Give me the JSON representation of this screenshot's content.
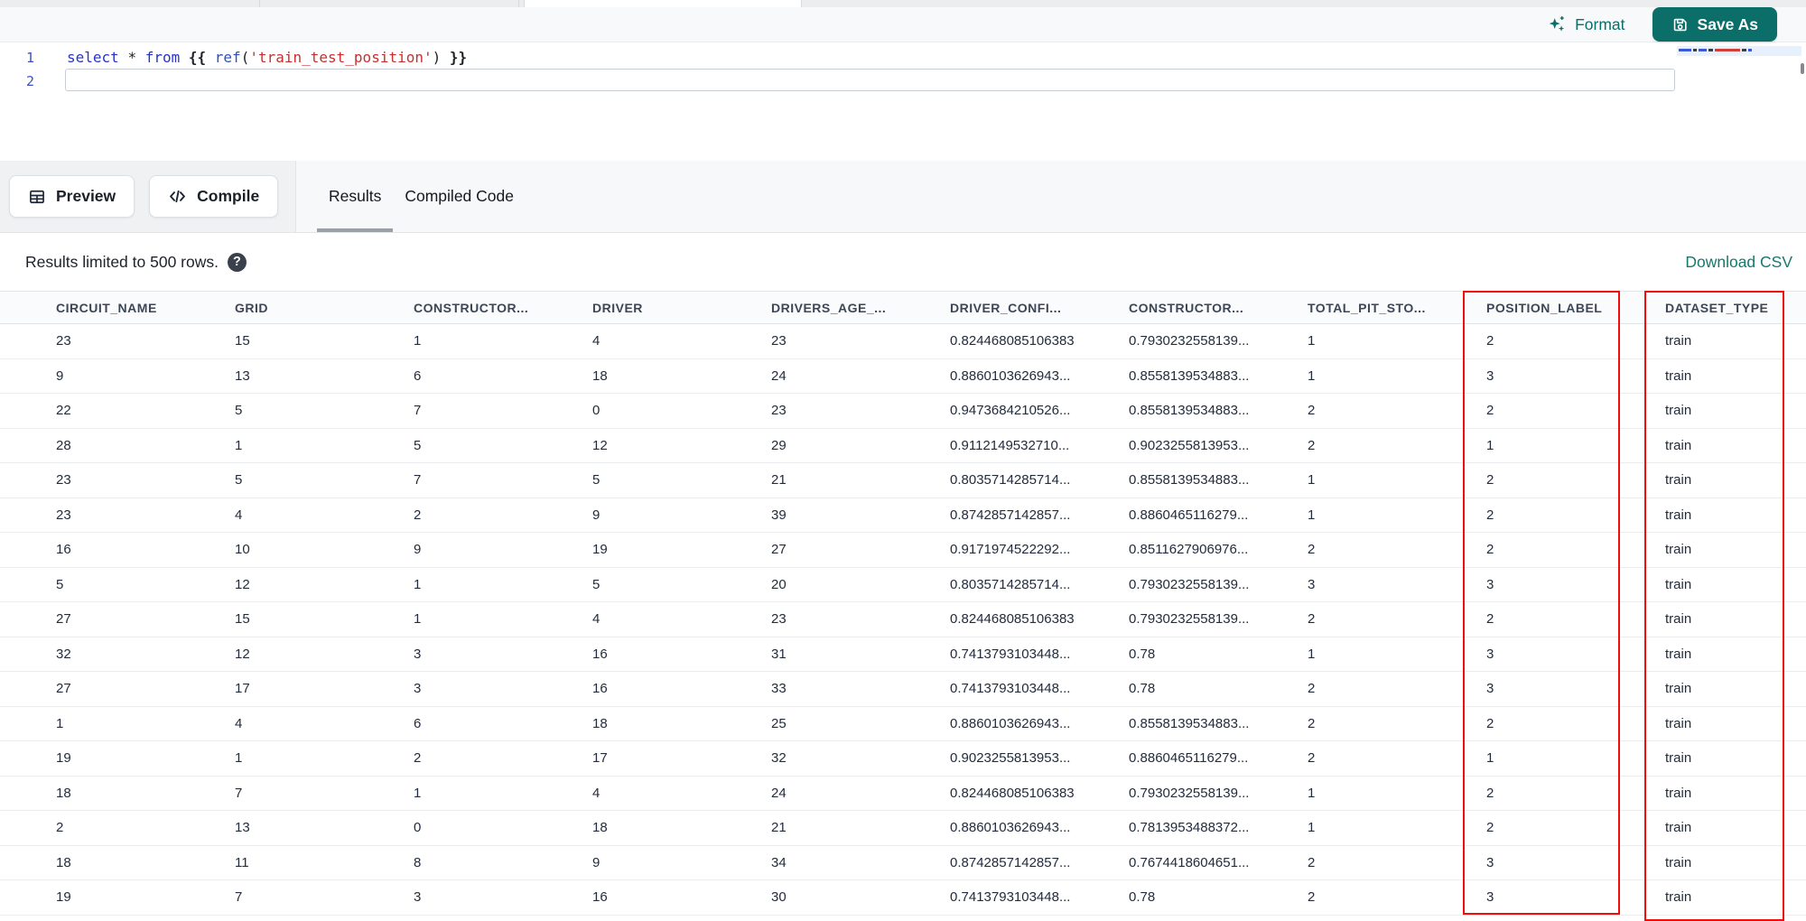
{
  "colors": {
    "accent_teal": "#0c6e68",
    "link_teal": "#17786f",
    "highlight_red": "#f20d0d",
    "keyword_blue": "#2733c9",
    "string_red": "#c92f2f"
  },
  "editor_header": {
    "format_label": "Format",
    "save_as_label": "Save As"
  },
  "editor": {
    "line_numbers": [
      "1",
      "2"
    ],
    "code_tokens": [
      {
        "t": "select ",
        "c": "kw"
      },
      {
        "t": "* ",
        "c": "pl"
      },
      {
        "t": "from ",
        "c": "kw"
      },
      {
        "t": "{{ ",
        "c": "br"
      },
      {
        "t": "ref",
        "c": "fn"
      },
      {
        "t": "(",
        "c": "pl"
      },
      {
        "t": "'train_test_position'",
        "c": "str"
      },
      {
        "t": ")",
        "c": "pl"
      },
      {
        "t": " }}",
        "c": "br"
      }
    ]
  },
  "toolbar": {
    "preview_label": "Preview",
    "compile_label": "Compile",
    "tabs": [
      {
        "label": "Results",
        "active": true
      },
      {
        "label": "Compiled Code",
        "active": false
      }
    ]
  },
  "results": {
    "limit_notice": "Results limited to 500 rows.",
    "download_csv_label": "Download CSV",
    "columns": [
      "CIRCUIT_NAME",
      "GRID",
      "CONSTRUCTOR...",
      "DRIVER",
      "DRIVERS_AGE_...",
      "DRIVER_CONFI...",
      "CONSTRUCTOR...",
      "TOTAL_PIT_STO...",
      "POSITION_LABEL",
      "DATASET_TYPE"
    ],
    "highlighted_columns": [
      "POSITION_LABEL",
      "DATASET_TYPE"
    ],
    "rows": [
      [
        "23",
        "15",
        "1",
        "4",
        "23",
        "0.824468085106383",
        "0.7930232558139...",
        "1",
        "2",
        "train"
      ],
      [
        "9",
        "13",
        "6",
        "18",
        "24",
        "0.8860103626943...",
        "0.8558139534883...",
        "1",
        "3",
        "train"
      ],
      [
        "22",
        "5",
        "7",
        "0",
        "23",
        "0.9473684210526...",
        "0.8558139534883...",
        "2",
        "2",
        "train"
      ],
      [
        "28",
        "1",
        "5",
        "12",
        "29",
        "0.9112149532710...",
        "0.9023255813953...",
        "2",
        "1",
        "train"
      ],
      [
        "23",
        "5",
        "7",
        "5",
        "21",
        "0.8035714285714...",
        "0.8558139534883...",
        "1",
        "2",
        "train"
      ],
      [
        "23",
        "4",
        "2",
        "9",
        "39",
        "0.8742857142857...",
        "0.8860465116279...",
        "1",
        "2",
        "train"
      ],
      [
        "16",
        "10",
        "9",
        "19",
        "27",
        "0.9171974522292...",
        "0.8511627906976...",
        "2",
        "2",
        "train"
      ],
      [
        "5",
        "12",
        "1",
        "5",
        "20",
        "0.8035714285714...",
        "0.7930232558139...",
        "3",
        "3",
        "train"
      ],
      [
        "27",
        "15",
        "1",
        "4",
        "23",
        "0.824468085106383",
        "0.7930232558139...",
        "2",
        "2",
        "train"
      ],
      [
        "32",
        "12",
        "3",
        "16",
        "31",
        "0.7413793103448...",
        "0.78",
        "1",
        "3",
        "train"
      ],
      [
        "27",
        "17",
        "3",
        "16",
        "33",
        "0.7413793103448...",
        "0.78",
        "2",
        "3",
        "train"
      ],
      [
        "1",
        "4",
        "6",
        "18",
        "25",
        "0.8860103626943...",
        "0.8558139534883...",
        "2",
        "2",
        "train"
      ],
      [
        "19",
        "1",
        "2",
        "17",
        "32",
        "0.9023255813953...",
        "0.8860465116279...",
        "2",
        "1",
        "train"
      ],
      [
        "18",
        "7",
        "1",
        "4",
        "24",
        "0.824468085106383",
        "0.7930232558139...",
        "1",
        "2",
        "train"
      ],
      [
        "2",
        "13",
        "0",
        "18",
        "21",
        "0.8860103626943...",
        "0.7813953488372...",
        "1",
        "2",
        "train"
      ],
      [
        "18",
        "11",
        "8",
        "9",
        "34",
        "0.8742857142857...",
        "0.7674418604651...",
        "2",
        "3",
        "train"
      ],
      [
        "19",
        "7",
        "3",
        "16",
        "30",
        "0.7413793103448...",
        "0.78",
        "2",
        "3",
        "train"
      ]
    ]
  }
}
